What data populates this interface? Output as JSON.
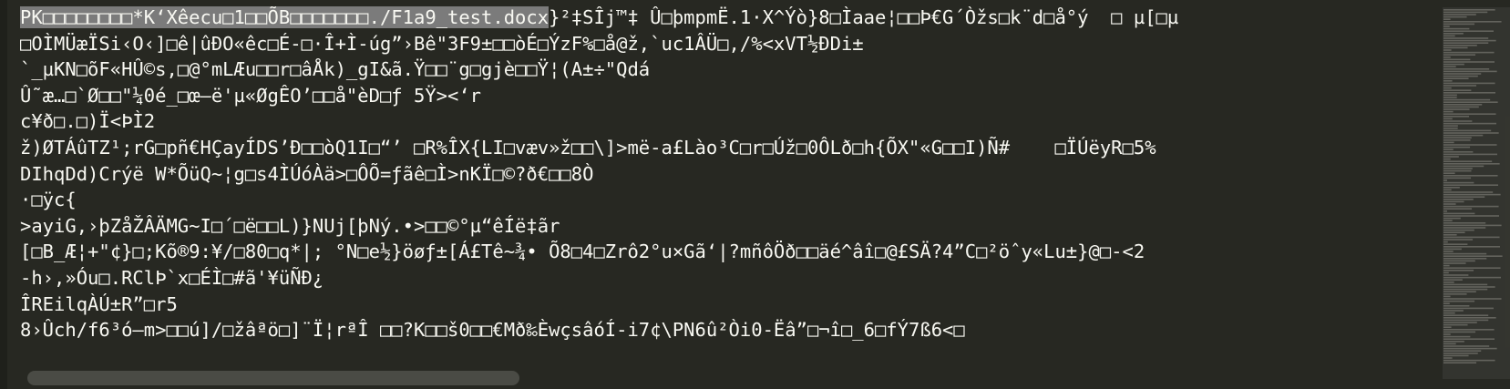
{
  "editor": {
    "selection": "PK□□□□□□□□*K‘Xêecu□1□□ÕB□□□□□□□./F1a9_test.docx",
    "first_line_rest": "}²‡SÎj™‡ Û□þmpmË.1·X^Ýò}8□Ìaae¦□□Þ€G´Òžs□k¨d□å°ý  □ µ[□µ",
    "lines": [
      "□OÌMÜæÏSi‹O‹]□ê|ûÐO«êc□É-□·Î+Ì-úg”›Bê\"3F9±□□òÉ□ÝzF%□å@ž,`uc1ÂÜ□,/%<xVT½ÐDi±",
      "`_µKN□õF«HÛ©s,□@°mLÆu□□r□âÅk)_gI&ã.Ÿ□□¨g□gjè□□Ÿ¦(A±÷\"Qdá",
      "Û˜æ…□`Ø□□\"¼0é_□œ—ë'µ«ØgÊO’□□å\"èD□ƒ 5Ÿ><‘r",
      "c¥ð□.□)Ï<ÞÌ2",
      "ž)ØTÁûTZ¹;rG□pñ€HÇayÍDS’Đ□□òQ1I□“’ □R%ÎX{LI□væv»ž□□\\]>më-a£Lào³C□r□Úž□0ÔLð□h{ÕX\"«G□□I)Ñ#    □ÏÚëyR□5%",
      "DIhqDd)Crýë W*ÕüQ~¦g□s4ÌÚóÀä>□ÔÕ=ƒãê□Ì>nKÏ□©?ð€□□8Ò",
      "·□ÿc{",
      ">ayiG,›þZåŽÂÄMG~I□´□ë□□L)}NUj[þNý.•>□□©°µ“êÍë‡ãr",
      "[□B_Æ¦+\"¢}□;Kõ®9:¥/□80□q*|; °N□e½}öøƒ±[Á£Tê~¾• Õ8□4□Zrô2°u×Gã‘|?mñôÖð□□äé^âî□@£SÄ?4”C□²öˆy«Lu±}@□-<2",
      "-h›,»Óu□.RClÞ`x□ÉÌ□#ã'¥üÑÐ¿",
      "ÎREilqÀÚ±R”□r5",
      "8›Ûch/f6³ó—m>□□ú]/□žâªö□]¨Ï¦rªÎ □□?K□□š0□□€Mð‰ÈwçsâóÍ-i7¢\\PN6û²Òi0-Ëâ”□¬î□_6□fÝ7ß6<□"
    ]
  },
  "colors": {
    "background": "#272822",
    "text": "#f8f8f2",
    "selection": "#7b7b7b",
    "scrollbar_thumb": "#4a4b45"
  }
}
